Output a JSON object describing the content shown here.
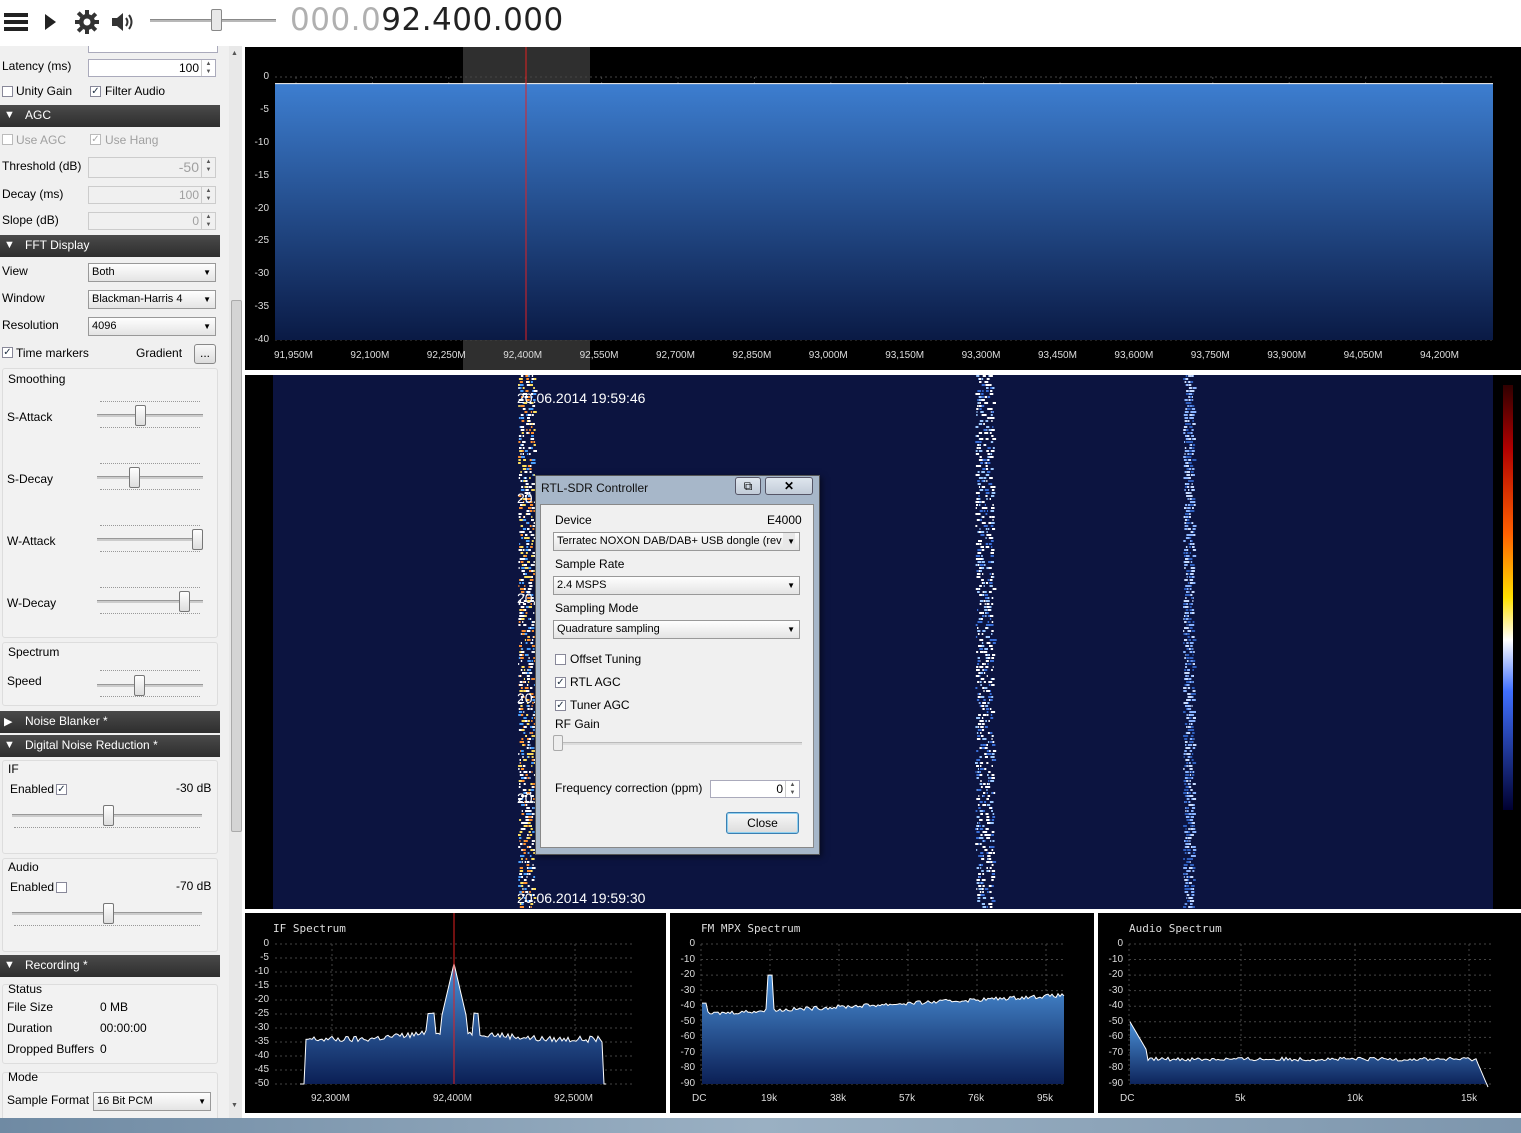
{
  "toolbar": {
    "menu_icon": "hamburger-icon",
    "play_icon": "play-icon",
    "settings_icon": "gear-icon",
    "volume_icon": "speaker-icon",
    "freq_dim": "000.0",
    "freq_main": "92.400.000"
  },
  "left": {
    "latency_label": "Latency (ms)",
    "latency_value": "100",
    "unity_gain": "Unity Gain",
    "filter_audio": "Filter Audio",
    "agc_title": "AGC",
    "use_agc": "Use AGC",
    "use_hang": "Use Hang",
    "threshold_label": "Threshold (dB)",
    "threshold_value": "-50",
    "decay_label": "Decay (ms)",
    "decay_value": "100",
    "slope_label": "Slope (dB)",
    "slope_value": "0",
    "fft_title": "FFT Display",
    "view_label": "View",
    "view_value": "Both",
    "window_label": "Window",
    "window_value": "Blackman-Harris 4",
    "resolution_label": "Resolution",
    "resolution_value": "4096",
    "time_markers": "Time markers",
    "gradient": "Gradient",
    "gradient_btn": "...",
    "smoothing": "Smoothing",
    "s_attack": "S-Attack",
    "s_decay": "S-Decay",
    "w_attack": "W-Attack",
    "w_decay": "W-Decay",
    "spectrum": "Spectrum",
    "speed": "Speed",
    "noise_blanker": "Noise Blanker *",
    "dnr": "Digital Noise Reduction *",
    "if_label": "IF",
    "if_enabled": "Enabled",
    "if_db": "-30 dB",
    "audio_label": "Audio",
    "audio_enabled": "Enabled",
    "audio_db": "-70 dB",
    "recording": "Recording *",
    "status": "Status",
    "file_size_label": "File Size",
    "file_size_value": "0 MB",
    "duration_label": "Duration",
    "duration_value": "00:00:00",
    "dropped_label": "Dropped Buffers",
    "dropped_value": "0",
    "mode": "Mode",
    "sample_format_label": "Sample Format",
    "sample_format_value": "16 Bit PCM"
  },
  "main_spectrum": {
    "y_ticks": [
      "0",
      "-5",
      "-10",
      "-15",
      "-20",
      "-25",
      "-30",
      "-35",
      "-40"
    ],
    "x_ticks": [
      "91,950M",
      "92,100M",
      "92,250M",
      "92,400M",
      "92,550M",
      "92,700M",
      "92,850M",
      "93,000M",
      "93,150M",
      "93,300M",
      "93,450M",
      "93,600M",
      "93,750M",
      "93,900M",
      "94,050M",
      "94,200M"
    ]
  },
  "waterfall": {
    "times": [
      "20.06.2014 19:59:46",
      "20.06.2014 19:59:43",
      "20.06.2014 19:59:39",
      "20.06.2014 19:59:36",
      "20.06.2014 19:59:33",
      "20.06.2014 19:59:30"
    ]
  },
  "if_spectrum": {
    "title": "IF Spectrum",
    "y_ticks": [
      "0",
      "-5",
      "-10",
      "-15",
      "-20",
      "-25",
      "-30",
      "-35",
      "-40",
      "-45",
      "-50"
    ],
    "x_ticks": [
      "92,300M",
      "92,400M",
      "92,500M"
    ]
  },
  "mpx_spectrum": {
    "title": "FM MPX Spectrum",
    "y_ticks": [
      "0",
      "-10",
      "-20",
      "-30",
      "-40",
      "-50",
      "-60",
      "-70",
      "-80",
      "-90"
    ],
    "x_ticks": [
      "DC",
      "19k",
      "38k",
      "57k",
      "76k",
      "95k"
    ]
  },
  "audio_spectrum": {
    "title": "Audio Spectrum",
    "y_ticks": [
      "0",
      "-10",
      "-20",
      "-30",
      "-40",
      "-50",
      "-60",
      "-70",
      "-80",
      "-90"
    ],
    "x_ticks": [
      "DC",
      "5k",
      "10k",
      "15k"
    ]
  },
  "dialog": {
    "title": "RTL-SDR Controller",
    "device_label": "Device",
    "device_type": "E4000",
    "device_value": "Terratec NOXON DAB/DAB+ USB dongle (rev",
    "sample_rate_label": "Sample Rate",
    "sample_rate_value": "2.4 MSPS",
    "sampling_mode_label": "Sampling Mode",
    "sampling_mode_value": "Quadrature sampling",
    "offset_tuning": "Offset Tuning",
    "rtl_agc": "RTL AGC",
    "tuner_agc": "Tuner AGC",
    "rf_gain": "RF Gain",
    "freq_corr_label": "Frequency correction (ppm)",
    "freq_corr_value": "0",
    "close": "Close",
    "restore_btn": "⧉",
    "close_x": "✕"
  }
}
